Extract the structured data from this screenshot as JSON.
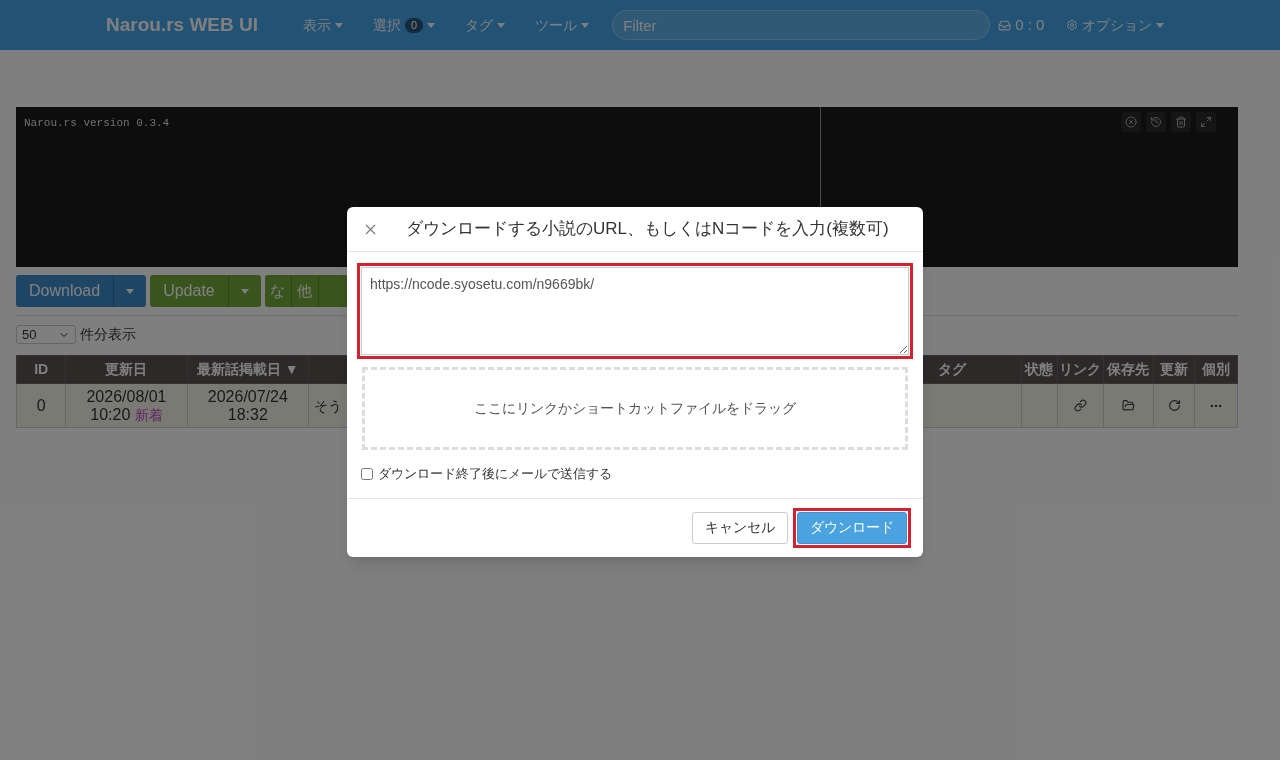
{
  "navbar": {
    "brand": "Narou.rs WEB UI",
    "menus": [
      {
        "label": "表示"
      },
      {
        "label": "選択",
        "badge": "0"
      },
      {
        "label": "タグ"
      },
      {
        "label": "ツール"
      }
    ],
    "filter": {
      "placeholder": "Filter"
    },
    "queue_status": "0 : 0",
    "options_menu": "オプション"
  },
  "console": {
    "lines": [
      "Narou.rs version 0.3.4"
    ]
  },
  "toolbar": {
    "buttons": [
      {
        "kind": "primary",
        "label": "Download"
      },
      {
        "kind": "success",
        "label": "Update"
      },
      {
        "kind": "group",
        "labels": [
          "な",
          "他"
        ]
      }
    ]
  },
  "page_size": {
    "value": "50",
    "label": "件分表示"
  },
  "table": {
    "columns": [
      {
        "label": "ID"
      },
      {
        "label": "更新日"
      },
      {
        "label": "最新話掲載日 ▼"
      },
      {},
      {
        "label": "タグ"
      },
      {
        "label": "状態"
      },
      {
        "label": "リンク"
      },
      {
        "label": "保存先"
      },
      {
        "label": "更新"
      },
      {
        "label": "個別"
      }
    ],
    "rows": [
      {
        "id": "0",
        "updated_date": "2026/08/01",
        "updated_time": "10:20",
        "new_badge": "新着",
        "posted_date": "2026/07/24",
        "posted_time": "18:32",
        "title": "そう"
      }
    ]
  },
  "dialog": {
    "title": "ダウンロードする小説のURL、もしくはNコードを入力(複数可)",
    "url_input": {
      "value": "https://ncode.syosetu.com/n9669bk/",
      "highlighted": true
    },
    "drop_zone": "ここにリンクかショートカットファイルをドラッグ",
    "email_option": {
      "label": "ダウンロード終了後にメールで送信する",
      "checked": false
    },
    "buttons": [
      {
        "kind": "cancel",
        "label": "キャンセル",
        "highlighted": false
      },
      {
        "kind": "primary",
        "label": "ダウンロード",
        "highlighted": true
      }
    ]
  }
}
